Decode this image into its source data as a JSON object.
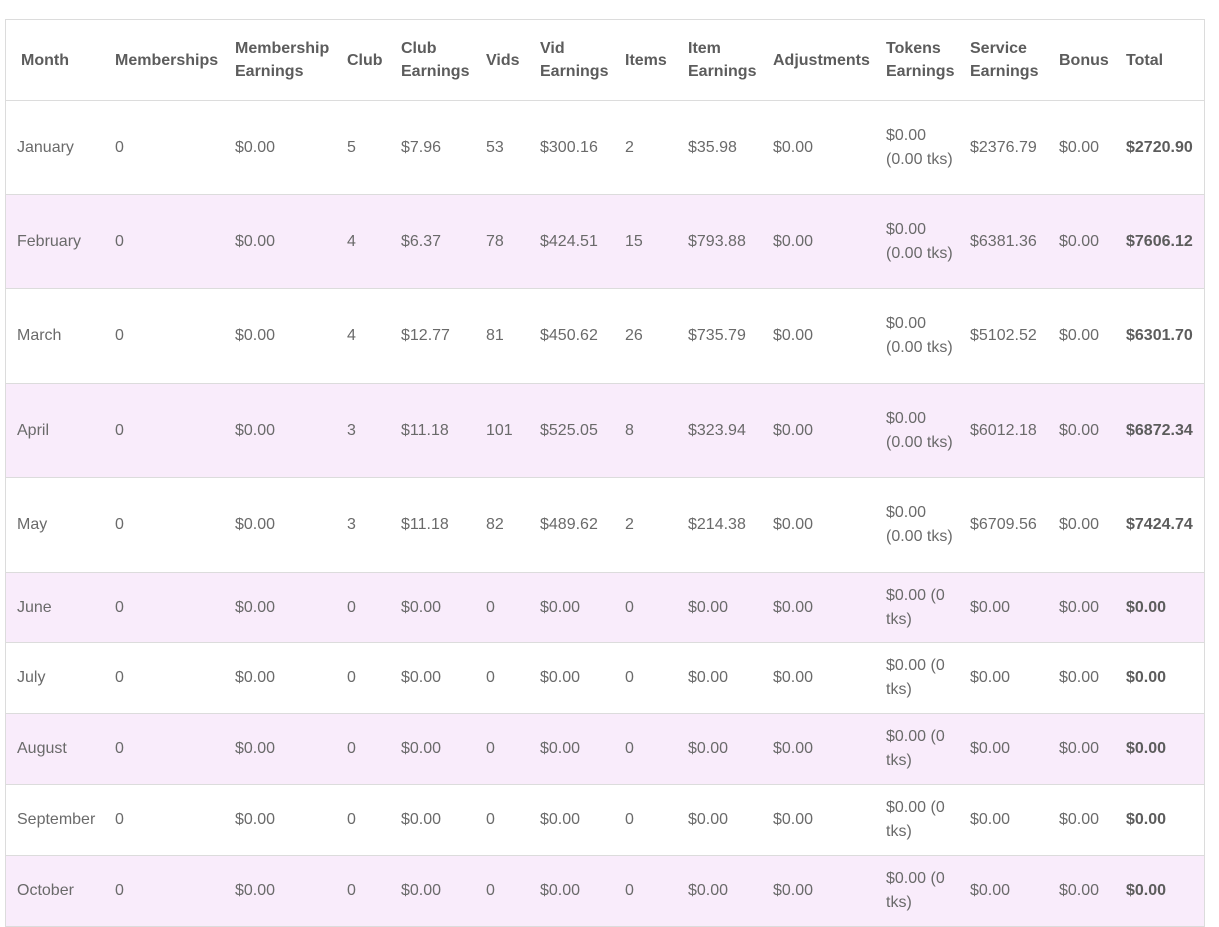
{
  "table": {
    "headers": [
      "Month",
      "Memberships",
      "Membership Earnings",
      "Club",
      "Club Earnings",
      "Vids",
      "Vid Earnings",
      "Items",
      "Item Earnings",
      "Adjustments",
      "Tokens Earnings",
      "Service Earnings",
      "Bonus",
      "Total"
    ],
    "rows": [
      [
        "January",
        "0",
        "$0.00",
        "5",
        "$7.96",
        "53",
        "$300.16",
        "2",
        "$35.98",
        "$0.00",
        "$0.00 (0.00 tks)",
        "$2376.79",
        "$0.00",
        "$2720.90"
      ],
      [
        "February",
        "0",
        "$0.00",
        "4",
        "$6.37",
        "78",
        "$424.51",
        "15",
        "$793.88",
        "$0.00",
        "$0.00 (0.00 tks)",
        "$6381.36",
        "$0.00",
        "$7606.12"
      ],
      [
        "March",
        "0",
        "$0.00",
        "4",
        "$12.77",
        "81",
        "$450.62",
        "26",
        "$735.79",
        "$0.00",
        "$0.00 (0.00 tks)",
        "$5102.52",
        "$0.00",
        "$6301.70"
      ],
      [
        "April",
        "0",
        "$0.00",
        "3",
        "$11.18",
        "101",
        "$525.05",
        "8",
        "$323.94",
        "$0.00",
        "$0.00 (0.00 tks)",
        "$6012.18",
        "$0.00",
        "$6872.34"
      ],
      [
        "May",
        "0",
        "$0.00",
        "3",
        "$11.18",
        "82",
        "$489.62",
        "2",
        "$214.38",
        "$0.00",
        "$0.00 (0.00 tks)",
        "$6709.56",
        "$0.00",
        "$7424.74"
      ],
      [
        "June",
        "0",
        "$0.00",
        "0",
        "$0.00",
        "0",
        "$0.00",
        "0",
        "$0.00",
        "$0.00",
        "$0.00 (0 tks)",
        "$0.00",
        "$0.00",
        "$0.00"
      ],
      [
        "July",
        "0",
        "$0.00",
        "0",
        "$0.00",
        "0",
        "$0.00",
        "0",
        "$0.00",
        "$0.00",
        "$0.00 (0 tks)",
        "$0.00",
        "$0.00",
        "$0.00"
      ],
      [
        "August",
        "0",
        "$0.00",
        "0",
        "$0.00",
        "0",
        "$0.00",
        "0",
        "$0.00",
        "$0.00",
        "$0.00 (0 tks)",
        "$0.00",
        "$0.00",
        "$0.00"
      ],
      [
        "September",
        "0",
        "$0.00",
        "0",
        "$0.00",
        "0",
        "$0.00",
        "0",
        "$0.00",
        "$0.00",
        "$0.00 (0 tks)",
        "$0.00",
        "$0.00",
        "$0.00"
      ],
      [
        "October",
        "0",
        "$0.00",
        "0",
        "$0.00",
        "0",
        "$0.00",
        "0",
        "$0.00",
        "$0.00",
        "$0.00 (0 tks)",
        "$0.00",
        "$0.00",
        "$0.00"
      ]
    ]
  }
}
